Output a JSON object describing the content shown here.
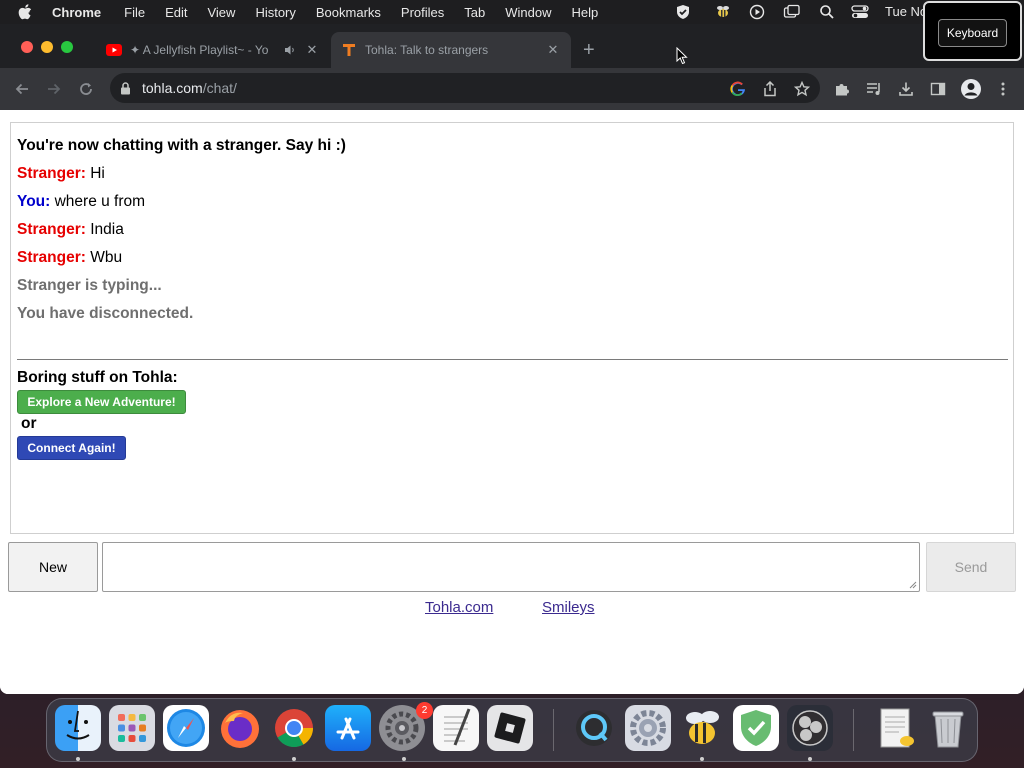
{
  "menubar": {
    "app_name": "Chrome",
    "items": [
      "File",
      "Edit",
      "View",
      "History",
      "Bookmarks",
      "Profiles",
      "Tab",
      "Window",
      "Help"
    ],
    "clock": "Tue No"
  },
  "keyboard_overlay": {
    "label": "Keyboard"
  },
  "browser": {
    "tabs": [
      {
        "title": "✦ A Jellyfish Playlist~ - Yo",
        "favicon": "youtube-icon",
        "audio": true,
        "active": false
      },
      {
        "title": "Tohla: Talk to strangers",
        "favicon": "tohla-icon",
        "audio": false,
        "active": true
      }
    ],
    "url_host": "tohla.com",
    "url_path": "/chat/"
  },
  "chat": {
    "intro": "You're now chatting with a stranger. Say hi :)",
    "messages": [
      {
        "sender": "Stranger:",
        "role": "stranger",
        "text": "Hi"
      },
      {
        "sender": "You:",
        "role": "you",
        "text": "where u from"
      },
      {
        "sender": "Stranger:",
        "role": "stranger",
        "text": "India"
      },
      {
        "sender": "Stranger:",
        "role": "stranger",
        "text": "Wbu"
      }
    ],
    "typing_status": "Stranger is typing...",
    "disconnect_status": "You have disconnected.",
    "boring_heading": "Boring stuff on Tohla:",
    "explore_button": "Explore a New Adventure!",
    "or_text": "or",
    "connect_button": "Connect Again!"
  },
  "controls": {
    "new_button": "New",
    "message_input_value": "",
    "send_button": "Send"
  },
  "footer": {
    "links": [
      "Tohla.com",
      "Smileys"
    ]
  },
  "dock": {
    "apps": [
      "finder-icon",
      "launchpad-icon",
      "safari-icon",
      "firefox-icon",
      "chrome-icon",
      "app-store-icon",
      "system-preferences-icon",
      "textedit-icon",
      "roblox-icon",
      "quicktime-icon",
      "settings-gear-icon",
      "bee-app-icon",
      "adguard-icon",
      "obs-icon",
      "document-icon",
      "trash-icon"
    ],
    "badge_count": "2"
  },
  "colors": {
    "stranger": "#e60000",
    "you": "#0000cc",
    "explore_button": "#4cae4c",
    "connect_button": "#2f49b5"
  }
}
